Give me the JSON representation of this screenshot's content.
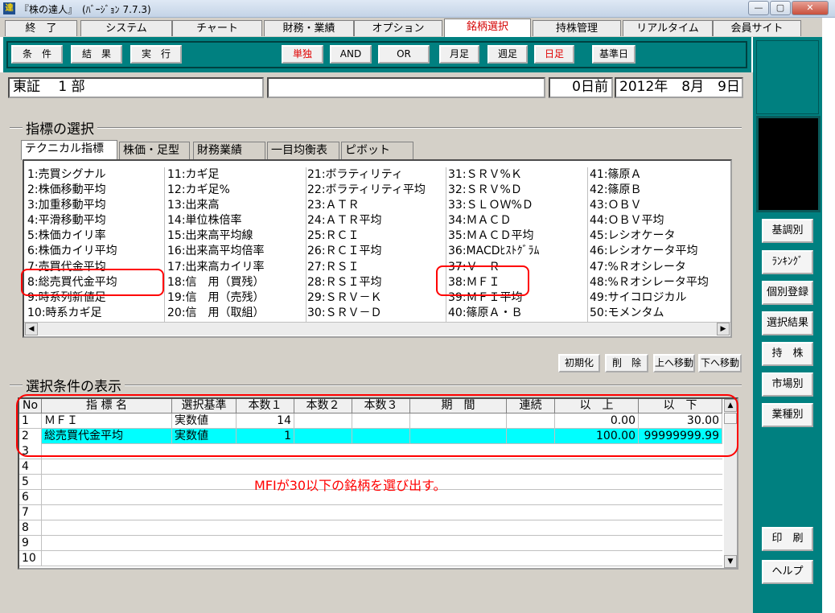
{
  "window": {
    "title": "『株の達人』　(ﾊﾞｰｼﾞｮﾝ 7.7.3)",
    "icon": "達",
    "min": "—",
    "max": "▢",
    "close": "✕"
  },
  "menu": [
    "終　了",
    "システム",
    "チャート",
    "財務・業績",
    "オプション",
    "銘柄選択",
    "持株管理",
    "リアルタイム",
    "会員サイト"
  ],
  "active_menu": "銘柄選択",
  "toolbar": {
    "buttons": [
      "条　件",
      "結　果",
      "実　行"
    ],
    "mode": [
      "単独",
      "AND",
      "OR"
    ],
    "period": [
      "月足",
      "週足",
      "日足"
    ],
    "base_date_button": "基準日"
  },
  "status": {
    "market": "東証　 1 部",
    "days_before": "0日前",
    "date": "2012年　8月　9日"
  },
  "indicator_section": {
    "title": "指標の選択",
    "tabs": [
      "テクニカル指標",
      "株価・足型",
      "財務業績",
      "一目均衡表",
      "ピボット"
    ],
    "columns": [
      [
        "1:売買シグナル",
        "2:株価移動平均",
        "3:加重移動平均",
        "4:平滑移動平均",
        "5:株価カイリ率",
        "6:株価カイリ平均",
        "7:売買代金平均",
        "8:総売買代金平均",
        "9:時系列新値足",
        "10:時系カギ足"
      ],
      [
        "11:カギ足",
        "12:カギ足%",
        "13:出来高",
        "14:単位株倍率",
        "15:出来高平均線",
        "16:出来高平均倍率",
        "17:出来高カイリ率",
        "18:信　用（買残）",
        "19:信　用（売残）",
        "20:信　用（取組）"
      ],
      [
        "21:ボラティリティ",
        "22:ボラティリティ平均",
        "23:ＡＴＲ",
        "24:ＡＴＲ平均",
        "25:ＲＣＩ",
        "26:ＲＣＩ平均",
        "27:ＲＳＩ",
        "28:ＲＳＩ平均",
        "29:ＳＲＶ－Ｋ",
        "30:ＳＲＶ－Ｄ"
      ],
      [
        "31:ＳＲＶ%Ｋ",
        "32:ＳＲＶ%Ｄ",
        "33:ＳＬＯＷ%Ｄ",
        "34:ＭＡＣＤ",
        "35:ＭＡＣＤ平均",
        "36:MACDﾋｽﾄｸﾞﾗﾑ",
        "37:Ｖ　Ｒ",
        "38:ＭＦＩ",
        "39:ＭＦＩ平均",
        "40:篠原Ａ・Ｂ"
      ],
      [
        "41:篠原Ａ",
        "42:篠原Ｂ",
        "43:ＯＢＶ",
        "44:ＯＢＶ平均",
        "45:レシオケータ",
        "46:レシオケータ平均",
        "47:%Ｒオシレータ",
        "48:%Ｒオシレータ平均",
        "49:サイコロジカル",
        "50:モメンタム"
      ]
    ],
    "buttons": [
      "初期化",
      "削　除",
      "上へ移動",
      "下へ移動"
    ]
  },
  "condition_section": {
    "title": "選択条件の表示",
    "headers": [
      "No",
      "指 標 名",
      "選択基準",
      "本数１",
      "本数２",
      "本数３",
      "期　間",
      "連続",
      "以　上",
      "以　下"
    ],
    "rows": [
      {
        "no": "1",
        "name": "ＭＦＩ",
        "criterion": "実数値",
        "n1": "14",
        "n2": "",
        "n3": "",
        "period": "",
        "cont": "",
        "min": "0.00",
        "max": "30.00"
      },
      {
        "no": "2",
        "name": "総売買代金平均",
        "criterion": "実数値",
        "n1": "1",
        "n2": "",
        "n3": "",
        "period": "",
        "cont": "",
        "min": "100.00",
        "max": "99999999.99"
      },
      {
        "no": "3"
      },
      {
        "no": "4"
      },
      {
        "no": "5"
      },
      {
        "no": "6"
      },
      {
        "no": "7"
      },
      {
        "no": "8"
      },
      {
        "no": "9"
      },
      {
        "no": "10"
      }
    ]
  },
  "right_buttons": [
    "基調別",
    "ﾗﾝｷﾝｸﾞ",
    "個別登録",
    "選択結果",
    "持　株",
    "市場別",
    "業種別"
  ],
  "bottom_right_buttons": [
    "印　刷",
    "ヘルプ"
  ],
  "annotation": "MFIが30以下の銘柄を選び出す。",
  "colors": {
    "teal": "#008080",
    "selected_row": "#00ffff",
    "annotation": "#ff0000"
  }
}
